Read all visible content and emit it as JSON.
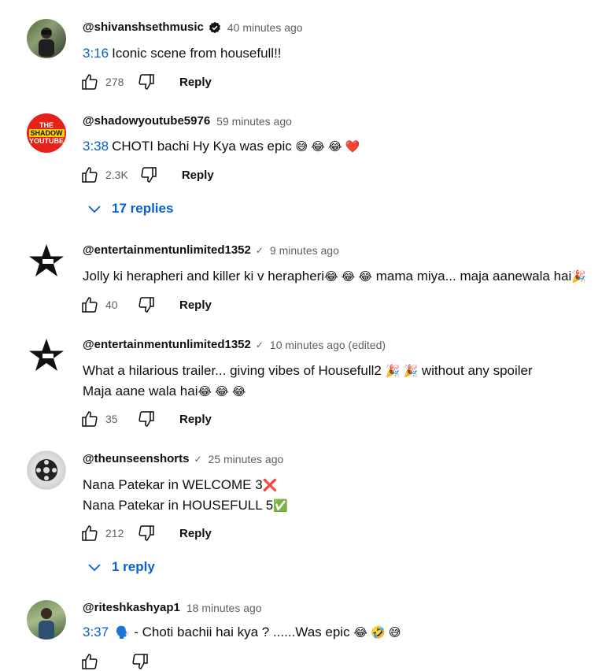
{
  "comments": [
    {
      "handle": "@shivanshsethmusic",
      "time": "40 minutes ago",
      "timestamp": "3:16",
      "text": "Iconic scene from housefull!!",
      "likes": "278",
      "reply_label": "Reply"
    },
    {
      "handle": "@shadowyoutube5976",
      "time": "59 minutes ago",
      "timestamp": "3:38",
      "text": "CHOTI bachi Hy Kya was epic",
      "emoji": "😅 😂 😂 ❤️",
      "likes": "2.3K",
      "reply_label": "Reply",
      "replies_label": "17 replies",
      "avatar_text": [
        "THE",
        "SHADOW",
        "YOUTUBE"
      ]
    },
    {
      "handle": "@entertainmentunlimited1352",
      "time": "9 minutes ago",
      "text": "Jolly ki herapheri and killer ki v herapheri",
      "emoji": "😂 😂 😂",
      "text_b": "mama miya... maja aanewala hai",
      "emoji_b": "🎉",
      "likes": "40",
      "reply_label": "Reply"
    },
    {
      "handle": "@entertainmentunlimited1352",
      "time": "10 minutes ago (edited)",
      "line1": "What a hilarious trailer... giving vibes of Housefull2",
      "line1_emoji": "🎉 🎉",
      "line1_b": "without any spoiler",
      "line2": "Maja aane wala hai",
      "line2_emoji": "😂 😂 😂",
      "likes": "35",
      "reply_label": "Reply"
    },
    {
      "handle": "@theunseenshorts",
      "time": "25 minutes ago",
      "line1": "Nana Patekar in WELCOME 3",
      "line1_emoji": "❌",
      "line2": "Nana Patekar in HOUSEFULL 5",
      "line2_emoji": "✅",
      "likes": "212",
      "reply_label": "Reply",
      "replies_label": "1 reply"
    },
    {
      "handle": "@riteshkashyap1",
      "time": "18 minutes ago",
      "timestamp": "3:37",
      "emoji_a": "🗣️",
      "text": "- Choti bachii hai kya ? ......Was epic",
      "emoji": "😂 🤣 😅"
    }
  ]
}
